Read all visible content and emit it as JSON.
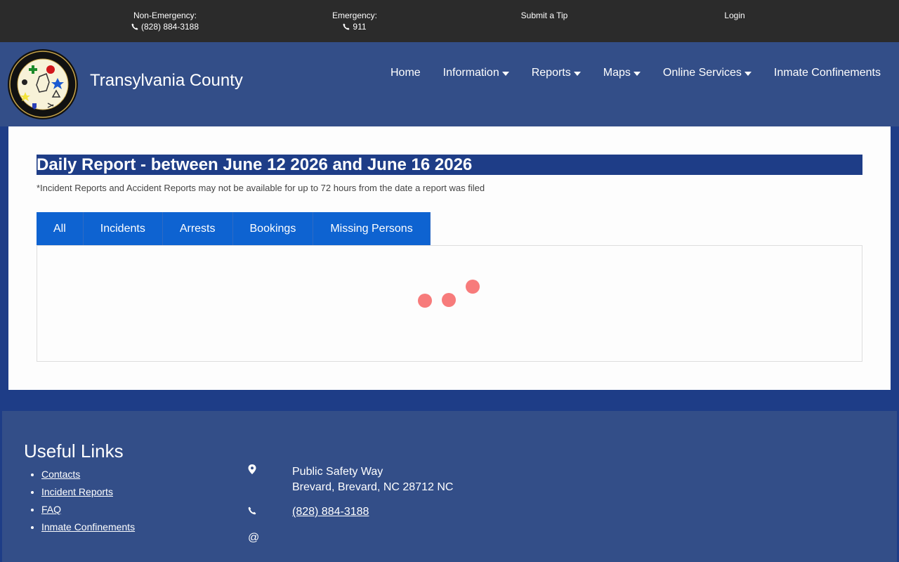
{
  "topbar": {
    "non_emergency_label": "Non-Emergency:",
    "non_emergency_phone": "(828) 884-3188",
    "emergency_label": "Emergency:",
    "emergency_phone": "911",
    "submit_tip": "Submit a Tip",
    "login": "Login"
  },
  "header": {
    "site_title": "Transylvania County",
    "nav": [
      "Home",
      "Information",
      "Reports",
      "Maps",
      "Online Services",
      "Inmate Confinements"
    ]
  },
  "main": {
    "report_title": "Daily Report - between June 12 2026 and June 16 2026",
    "note": "*Incident Reports and Accident Reports may not be available for up to 72 hours from the date a report was filed",
    "tabs": [
      "All",
      "Incidents",
      "Arrests",
      "Bookings",
      "Missing Persons"
    ]
  },
  "footer": {
    "useful_links_title": "Useful Links",
    "links": [
      "Contacts",
      "Incident Reports",
      "FAQ",
      "Inmate Confinements"
    ],
    "address_line1": "Public Safety Way",
    "address_line2": "Brevard, Brevard, NC 28712 NC",
    "phone": "(828) 884-3188",
    "email_symbol": "@"
  },
  "colors": {
    "topbar_bg": "#2b2b2b",
    "header_bg": "#334e88",
    "title_bar_bg": "#1e3d87",
    "tab_bg": "#0e63d1",
    "loader_dot": "#f77b7b"
  },
  "icons": [
    "phone-icon",
    "map-marker-icon",
    "caret-down-icon",
    "county-seal-logo"
  ]
}
